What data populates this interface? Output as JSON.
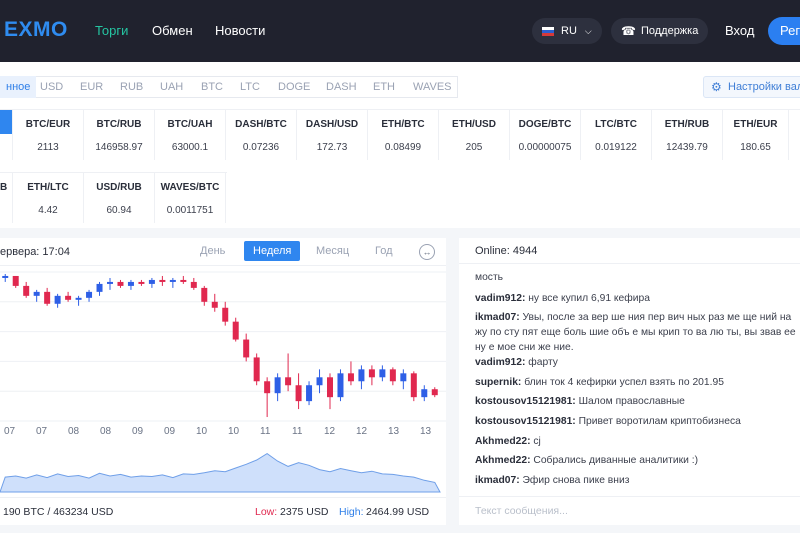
{
  "header": {
    "logo": "EXMO",
    "nav": [
      "Торги",
      "Обмен",
      "Новости"
    ],
    "lang": "RU",
    "support": "Поддержка",
    "login": "Вход",
    "register": "Рег"
  },
  "tabs": [
    "нное",
    "USD",
    "EUR",
    "RUB",
    "UAH",
    "BTC",
    "LTC",
    "DOGE",
    "DASH",
    "ETH",
    "WAVES"
  ],
  "settings_label": "Настройки вал",
  "rates_row1": [
    {
      "pair": "BTC/EUR",
      "value": "2113"
    },
    {
      "pair": "BTC/RUB",
      "value": "146958.97"
    },
    {
      "pair": "BTC/UAH",
      "value": "63000.1"
    },
    {
      "pair": "DASH/BTC",
      "value": "0.07236"
    },
    {
      "pair": "DASH/USD",
      "value": "172.73"
    },
    {
      "pair": "ETH/BTC",
      "value": "0.08499"
    },
    {
      "pair": "ETH/USD",
      "value": "205"
    },
    {
      "pair": "DOGE/BTC",
      "value": "0.00000075"
    },
    {
      "pair": "LTC/BTC",
      "value": "0.019122"
    },
    {
      "pair": "ETH/RUB",
      "value": "12439.79"
    },
    {
      "pair": "ETH/EUR",
      "value": "180.65"
    }
  ],
  "rates_row2": [
    {
      "pair": "ETH/LTC",
      "value": "4.42"
    },
    {
      "pair": "USD/RUB",
      "value": "60.94"
    },
    {
      "pair": "WAVES/BTC",
      "value": "0.0011751"
    }
  ],
  "chart": {
    "server_time": "ервера: 17:04",
    "periods": [
      "День",
      "Неделя",
      "Месяц",
      "Год"
    ],
    "volume_text": "190 BTC / 463234 USD",
    "low_label": "Low:",
    "low_value": "2375 USD",
    "high_label": "High:",
    "high_value": "2464.99 USD"
  },
  "chart_data": {
    "type": "candlestick",
    "x_ticks": [
      "07",
      "07",
      "08",
      "08",
      "09",
      "09",
      "10",
      "10",
      "11",
      "11",
      "12",
      "12",
      "13",
      "13"
    ],
    "colors": {
      "up": "#2e5fe6",
      "down": "#e0284f"
    },
    "note": "Candle values unlabeled on axis; OHLC given in relative price units",
    "candles": [
      [
        72,
        74,
        70,
        73
      ],
      [
        73,
        73,
        67,
        68
      ],
      [
        68,
        70,
        62,
        63
      ],
      [
        63,
        66,
        60,
        65
      ],
      [
        65,
        67,
        58,
        59
      ],
      [
        59,
        64,
        57,
        63
      ],
      [
        63,
        65,
        60,
        61
      ],
      [
        61,
        63,
        58,
        62
      ],
      [
        62,
        66,
        60,
        65
      ],
      [
        65,
        70,
        63,
        69
      ],
      [
        69,
        72,
        66,
        70
      ],
      [
        70,
        71,
        67,
        68
      ],
      [
        68,
        71,
        66,
        70
      ],
      [
        70,
        71,
        68,
        69
      ],
      [
        69,
        72,
        67,
        71
      ],
      [
        71,
        73,
        68,
        70
      ],
      [
        70,
        72,
        67,
        71
      ],
      [
        71,
        73,
        69,
        70
      ],
      [
        70,
        72,
        66,
        67
      ],
      [
        67,
        68,
        58,
        60
      ],
      [
        60,
        64,
        55,
        57
      ],
      [
        57,
        60,
        48,
        50
      ],
      [
        50,
        52,
        40,
        41
      ],
      [
        41,
        44,
        30,
        32
      ],
      [
        32,
        34,
        18,
        20
      ],
      [
        20,
        22,
        2,
        14
      ],
      [
        14,
        24,
        10,
        22
      ],
      [
        22,
        34,
        15,
        18
      ],
      [
        18,
        24,
        6,
        10
      ],
      [
        10,
        20,
        8,
        18
      ],
      [
        18,
        26,
        14,
        22
      ],
      [
        22,
        24,
        6,
        12
      ],
      [
        12,
        26,
        10,
        24
      ],
      [
        24,
        30,
        18,
        20
      ],
      [
        20,
        28,
        16,
        26
      ],
      [
        26,
        28,
        18,
        22
      ],
      [
        22,
        28,
        20,
        26
      ],
      [
        26,
        27,
        18,
        20
      ],
      [
        20,
        26,
        16,
        24
      ],
      [
        24,
        25,
        10,
        12
      ],
      [
        12,
        18,
        10,
        16
      ],
      [
        16,
        17,
        12,
        13
      ]
    ],
    "volume": [
      28,
      30,
      26,
      32,
      27,
      34,
      29,
      31,
      26,
      35,
      30,
      33,
      28,
      30,
      29,
      32,
      27,
      34,
      33,
      36,
      40,
      38,
      45,
      52,
      60,
      72,
      58,
      48,
      55,
      50,
      42,
      38,
      44,
      40,
      36,
      39,
      34,
      33,
      30,
      28,
      22,
      18
    ]
  },
  "chat": {
    "online": "Online: 4944",
    "top_fragment": "мость",
    "messages": [
      {
        "user": "vadim912:",
        "text": "ну все купил 6,91 кефира"
      },
      {
        "user": "ikmad07:",
        "text": "Увы, после за вер ше ния пер вич ных раз ме ще ний на жу по сту пят еще боль шие объ е мы крип то ва лю ты, вы звав ее ну е мое сни же ние."
      },
      {
        "user": "vadim912:",
        "text": "фарту"
      },
      {
        "user": "supernik:",
        "text": "блин ток 4 кефирки успел взять по 201.95"
      },
      {
        "user": "kostousov15121981:",
        "text": "Шалом православные"
      },
      {
        "user": "kostousov15121981:",
        "text": "Привет воротилам криптобизнеса"
      },
      {
        "user": "Akhmed22:",
        "text": "cj"
      },
      {
        "user": "Akhmed22:",
        "text": "Собрались диванные аналитики :)"
      },
      {
        "user": "ikmad07:",
        "text": "Эфир снова пике вниз"
      }
    ],
    "input_placeholder": "Текст сообщения..."
  }
}
